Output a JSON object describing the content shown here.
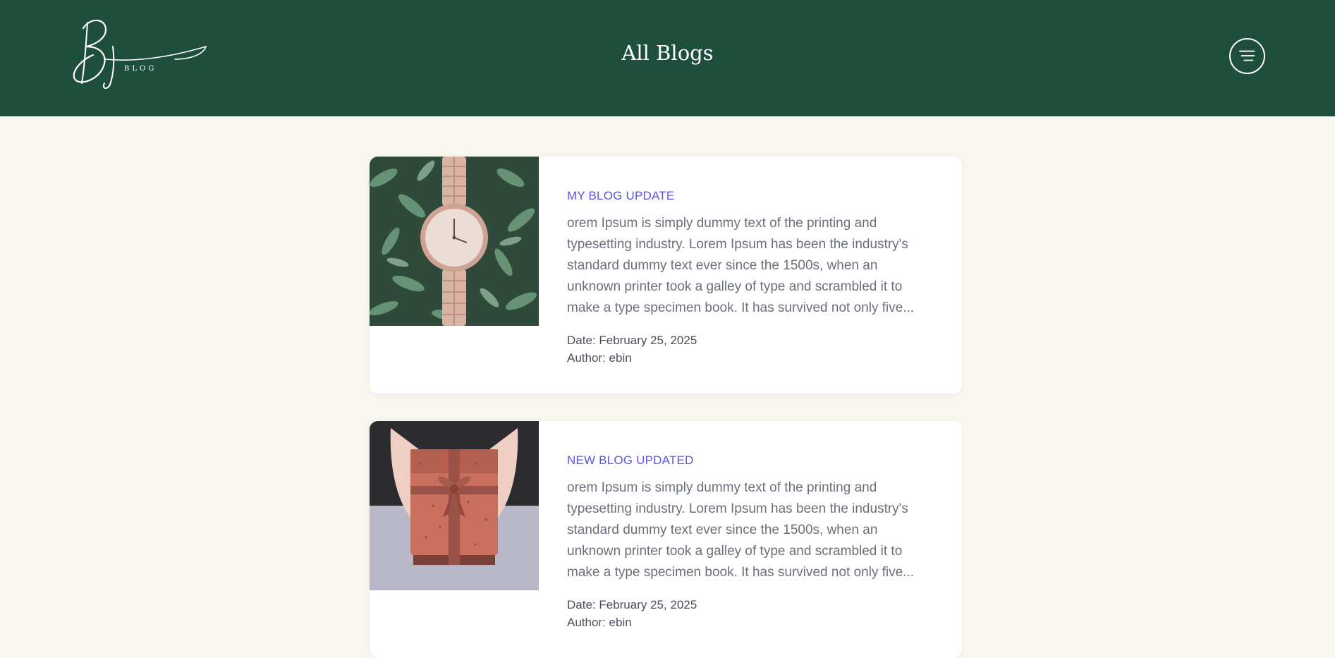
{
  "header": {
    "logo_text": "BLOG",
    "title": "All Blogs",
    "menu_icon": "hamburger-menu-icon",
    "background": "#1e4f3c"
  },
  "theme": {
    "page_background": "#faf6f0",
    "title_color": "#5b55e6",
    "text_color": "#6b6f7a"
  },
  "posts": [
    {
      "title": "MY BLOG UPDATE",
      "excerpt": "orem Ipsum is simply dummy text of the printing and typesetting industry. Lorem Ipsum has been the industry's standard dummy text ever since the 1500s, when an unknown printer took a galley of type and scrambled it to make a type specimen book. It has survived not only five...",
      "date": "Date: February 25, 2025",
      "author": "Author: ebin",
      "image": "wristwatch-on-leaves"
    },
    {
      "title": "NEW BLOG UPDATED",
      "excerpt": "orem Ipsum is simply dummy text of the printing and typesetting industry. Lorem Ipsum has been the industry's standard dummy text ever since the 1500s, when an unknown printer took a galley of type and scrambled it to make a type specimen book. It has survived not only five...",
      "date": "Date: February 25, 2025",
      "author": "Author: ebin",
      "image": "gift-box-in-hands"
    }
  ]
}
